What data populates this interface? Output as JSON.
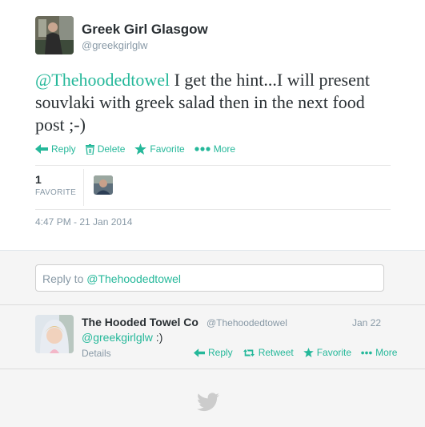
{
  "tweet": {
    "author_name": "Greek Girl Glasgow",
    "author_handle": "@greekgirlglw",
    "mention": "@Thehoodedtowel",
    "text": " I get the hint...I will present souvlaki with greek salad then in the next food post ;-)",
    "actions": {
      "reply": "Reply",
      "delete": "Delete",
      "favorite": "Favorite",
      "more": "More"
    },
    "favorites_count": "1",
    "favorites_label": "FAVORITE",
    "timestamp": "4:47 PM - 21 Jan 2014"
  },
  "reply_box": {
    "prefix": "Reply to ",
    "mention": "@Thehoodedtowel"
  },
  "reply_tweet": {
    "author_name": "The Hooded Towel Co",
    "author_handle": "@Thehoodedtowel",
    "date": "Jan 22",
    "mention": "@greekgirlglw",
    "text": " :)",
    "details": "Details",
    "actions": {
      "reply": "Reply",
      "retweet": "Retweet",
      "favorite": "Favorite",
      "more": "More"
    }
  },
  "colors": {
    "accent": "#25b89a",
    "muted": "#8899a6",
    "text": "#292f33"
  },
  "icons": [
    "reply-icon",
    "delete-icon",
    "star-icon",
    "more-icon",
    "retweet-icon",
    "twitter-bird-icon"
  ]
}
